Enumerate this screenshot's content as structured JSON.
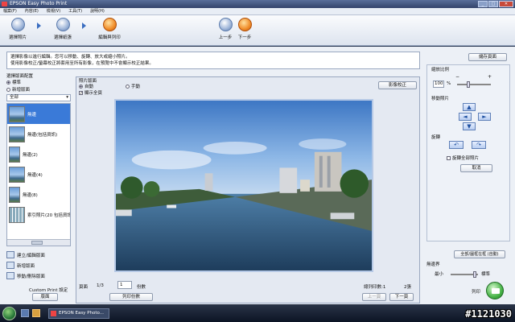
{
  "window": {
    "title": "EPSON Easy Photo Print"
  },
  "menu": [
    "檔案(F)",
    "內容(E)",
    "檢視(V)",
    "工具(T)",
    "說明(H)"
  ],
  "steps": [
    {
      "label": "選擇照片"
    },
    {
      "label": "選擇紙張"
    },
    {
      "label": "編輯與列印"
    }
  ],
  "undo": {
    "label": "上一步"
  },
  "redo": {
    "label": "下一步"
  },
  "message": {
    "line1": "選擇影像以進行編輯。您可以移動、旋轉、放大或縮小照片。",
    "line2": "使用影像校正/螢幕校正將套用至所有影像，在預覽中不會顯示校正結果。"
  },
  "left": {
    "layout_title": "選擇版面配置",
    "radio_standard": "標準",
    "radio_new": "新增版面",
    "filter_value": "全部",
    "thumbs": [
      {
        "label": "無邊",
        "kind": "wide"
      },
      {
        "label": "無邊(包括資訊)",
        "kind": "wide"
      },
      {
        "label": "無邊(2)",
        "kind": "tall"
      },
      {
        "label": "無邊(4)",
        "kind": "wide"
      },
      {
        "label": "無邊(8)",
        "kind": "tall"
      },
      {
        "label": "索引照片(20 包括資訊)",
        "kind": "grid"
      }
    ],
    "actions": [
      {
        "label": "建立/編輯版面"
      },
      {
        "label": "新增版面"
      },
      {
        "label": "移動/刪除版面"
      }
    ],
    "custom_label": "Custom Print 設定",
    "settings_button": "版面"
  },
  "center": {
    "layout_header": "照片版面",
    "radio_auto": "自動",
    "radio_manual": "手動",
    "checkbox_show_all": "顯示全頁",
    "image_correction_button": "影像校正",
    "page_label": "頁面",
    "page_value": "1/3",
    "copies_value": "1",
    "copies_label": "份數",
    "print_copies_button": "列印份數",
    "selected_label": "總列印數:1",
    "selected_count": "2張",
    "prev_page": "上一頁",
    "next_page": "下一頁"
  },
  "right": {
    "save_page_button": "儲存頁面",
    "zoom_title": "縮放比例",
    "zoom_value": "100",
    "zoom_unit": "%",
    "move_title": "移動照片",
    "rotate_title": "旋轉",
    "rotate_all_label": "旋轉全部照片",
    "cancel_button": "取消",
    "all_fit_button": "全部/圖框在框 (自動)",
    "copies_title": "無邊界",
    "slider_min": "最小",
    "slider_std": "標準",
    "print_label": "列印"
  },
  "taskbar": {
    "app_item": "EPSON Easy Photo..."
  },
  "watermark": "#1121030"
}
